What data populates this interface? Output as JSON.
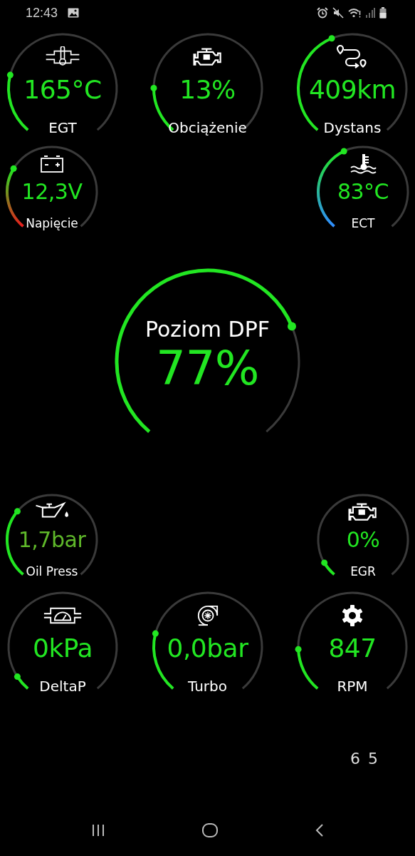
{
  "status_bar": {
    "time": "12:43"
  },
  "rows": [
    {
      "gauges": [
        {
          "label": "EGT",
          "value": "165°C",
          "kind": "green",
          "color": "#22e622"
        },
        {
          "label": "Obciążenie",
          "value": "13%",
          "kind": "green",
          "color": "#22e622"
        },
        {
          "label": "Dystans",
          "value": "409km",
          "kind": "green",
          "color": "#22e622"
        }
      ]
    },
    {
      "gauges": [
        {
          "label": "Napięcie",
          "value": "12,3V",
          "kind": "voltage",
          "color": "#22e622"
        },
        {
          "label": "ECT",
          "value": "83°C",
          "kind": "coolant",
          "color": "#22e622"
        }
      ]
    },
    {
      "gauges": [
        {
          "label": "Poziom DPF",
          "value": "77%",
          "kind": "green",
          "color": "#22e622"
        }
      ]
    },
    {
      "gauges": [
        {
          "label": "Oil Press",
          "value": "1,7bar",
          "kind": "green",
          "color": "#5fb82a"
        },
        {
          "label": "EGR",
          "value": "0%",
          "kind": "green",
          "color": "#22e622"
        }
      ]
    },
    {
      "gauges": [
        {
          "label": "DeltaP",
          "value": "0kPa",
          "kind": "green",
          "color": "#22e622"
        },
        {
          "label": "Turbo",
          "value": "0,0bar",
          "kind": "green",
          "color": "#22e622"
        },
        {
          "label": "RPM",
          "value": "847",
          "kind": "green",
          "color": "#22e622"
        }
      ]
    }
  ],
  "footer": "6 5"
}
